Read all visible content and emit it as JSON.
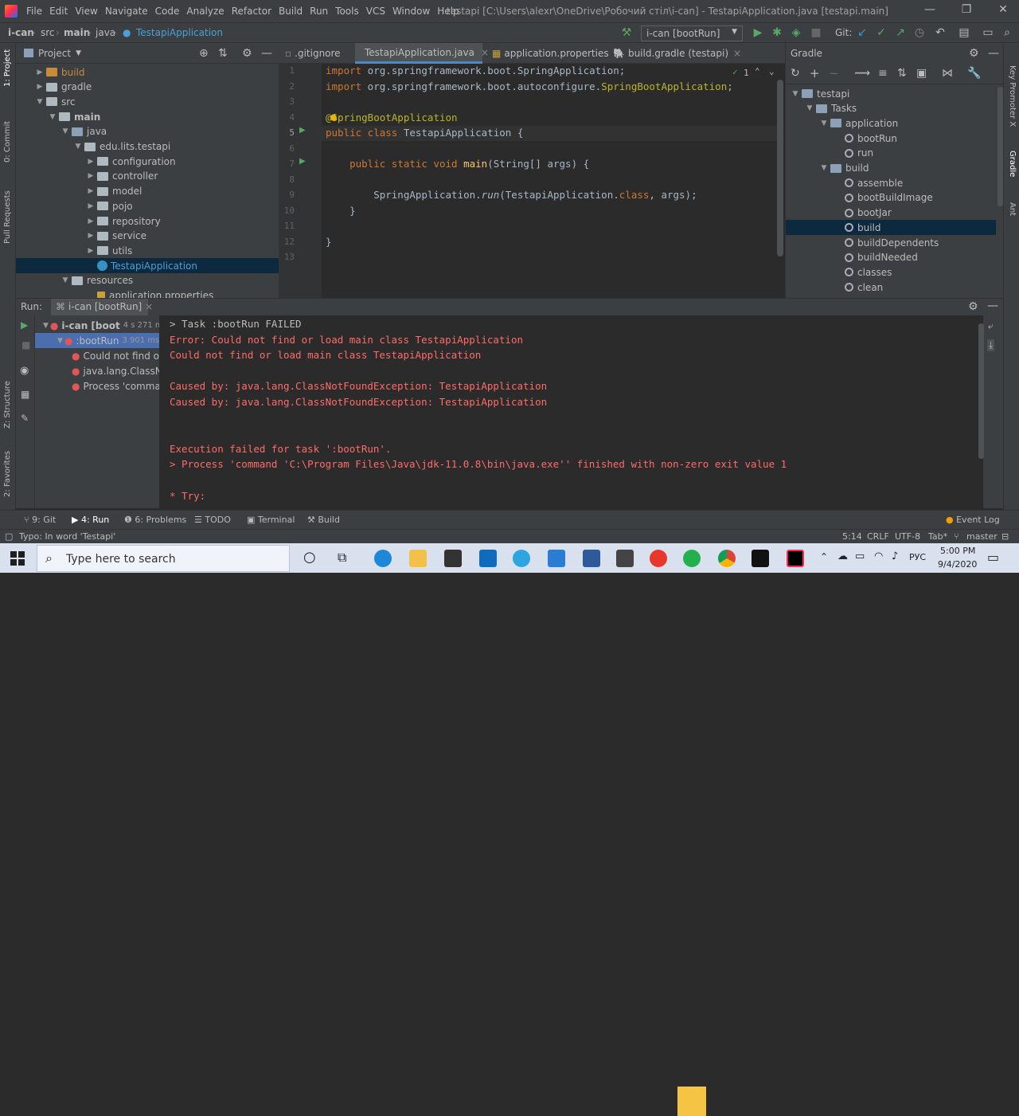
{
  "menu": [
    "File",
    "Edit",
    "View",
    "Navigate",
    "Code",
    "Analyze",
    "Refactor",
    "Build",
    "Run",
    "Tools",
    "VCS",
    "Window",
    "Help"
  ],
  "window_title": "testapi [C:\\Users\\alexr\\OneDrive\\Робочий стіл\\i-can] - TestapiApplication.java [testapi.main]",
  "breadcrumb": [
    "i-can",
    "src",
    "main",
    "java",
    "TestapiApplication"
  ],
  "run_config": "i-can [bootRun]",
  "git_label": "Git:",
  "project": {
    "header": "Project",
    "items": [
      {
        "label": "build",
        "depth": 1,
        "arrow": "▶",
        "kind": "orange"
      },
      {
        "label": "gradle",
        "depth": 1,
        "arrow": "▶",
        "kind": "folder"
      },
      {
        "label": "src",
        "depth": 1,
        "arrow": "▼",
        "kind": "folder"
      },
      {
        "label": "main",
        "depth": 2,
        "arrow": "▼",
        "kind": "folder"
      },
      {
        "label": "java",
        "depth": 3,
        "arrow": "▼",
        "kind": "blue"
      },
      {
        "label": "edu.lits.testapi",
        "depth": 4,
        "arrow": "▼",
        "kind": "folder"
      },
      {
        "label": "configuration",
        "depth": 5,
        "arrow": "▶",
        "kind": "folder"
      },
      {
        "label": "controller",
        "depth": 5,
        "arrow": "▶",
        "kind": "folder"
      },
      {
        "label": "model",
        "depth": 5,
        "arrow": "▶",
        "kind": "folder"
      },
      {
        "label": "pojo",
        "depth": 5,
        "arrow": "▶",
        "kind": "folder"
      },
      {
        "label": "repository",
        "depth": 5,
        "arrow": "▶",
        "kind": "folder"
      },
      {
        "label": "service",
        "depth": 5,
        "arrow": "▶",
        "kind": "folder"
      },
      {
        "label": "utils",
        "depth": 5,
        "arrow": "▶",
        "kind": "folder"
      },
      {
        "label": "TestapiApplication",
        "depth": 5,
        "arrow": "",
        "kind": "java",
        "selected": true
      },
      {
        "label": "resources",
        "depth": 3,
        "arrow": "▼",
        "kind": "folder"
      },
      {
        "label": "application.properties",
        "depth": 5,
        "arrow": "",
        "kind": "file"
      }
    ]
  },
  "tabs": [
    ".gitignore",
    "TestapiApplication.java",
    "application.properties",
    "build.gradle (testapi)"
  ],
  "editor": {
    "line_numbers": [
      "1",
      "2",
      "3",
      "4",
      "5",
      "6",
      "7",
      "8",
      "9",
      "10",
      "11",
      "12",
      "13"
    ],
    "inspection": "1",
    "lines": [
      {
        "html": "<span class=\"kw\">import</span> org.springframework.boot.SpringApplication;"
      },
      {
        "html": "<span class=\"kw\">import</span> org.springframework.boot.autoconfigure.<span class=\"ann\">SpringBootApplication</span>;"
      },
      {
        "html": ""
      },
      {
        "html": "<span class=\"ann\">@SpringBootApplication</span>"
      },
      {
        "html": "<span class=\"kw\">public class</span> TestapiApplication {"
      },
      {
        "html": ""
      },
      {
        "html": "    <span class=\"kw\">public static void</span> <span class=\"fn\">main</span>(String[] args) {"
      },
      {
        "html": ""
      },
      {
        "html": "        SpringApplication.<span class=\"it\">run</span>(TestapiApplication.<span class=\"kw\">class</span>, args);"
      },
      {
        "html": "    }"
      },
      {
        "html": ""
      },
      {
        "html": "}"
      },
      {
        "html": ""
      }
    ]
  },
  "gradle": {
    "header": "Gradle",
    "items": [
      {
        "label": "testapi",
        "depth": 0,
        "arrow": "▼"
      },
      {
        "label": "Tasks",
        "depth": 1,
        "arrow": "▼"
      },
      {
        "label": "application",
        "depth": 2,
        "arrow": "▼"
      },
      {
        "label": "bootRun",
        "depth": 3,
        "arrow": "",
        "gear": true
      },
      {
        "label": "run",
        "depth": 3,
        "arrow": "",
        "gear": true
      },
      {
        "label": "build",
        "depth": 2,
        "arrow": "▼"
      },
      {
        "label": "assemble",
        "depth": 3,
        "arrow": "",
        "gear": true
      },
      {
        "label": "bootBuildImage",
        "depth": 3,
        "arrow": "",
        "gear": true
      },
      {
        "label": "bootJar",
        "depth": 3,
        "arrow": "",
        "gear": true
      },
      {
        "label": "build",
        "depth": 3,
        "arrow": "",
        "gear": true,
        "selected": true
      },
      {
        "label": "buildDependents",
        "depth": 3,
        "arrow": "",
        "gear": true
      },
      {
        "label": "buildNeeded",
        "depth": 3,
        "arrow": "",
        "gear": true
      },
      {
        "label": "classes",
        "depth": 3,
        "arrow": "",
        "gear": true
      },
      {
        "label": "clean",
        "depth": 3,
        "arrow": "",
        "gear": true
      }
    ]
  },
  "run": {
    "label": "Run:",
    "tab": "i-can [bootRun]",
    "tree": [
      {
        "label": "i-can [boot",
        "time": "4 s 271 ms",
        "depth": 0,
        "selected": false
      },
      {
        "label": ":bootRun",
        "time": "3 901 ms",
        "depth": 1,
        "selected": true
      },
      {
        "label": "Could not find o",
        "depth": 2
      },
      {
        "label": "java.lang.ClassN",
        "depth": 2
      },
      {
        "label": "Process 'comma",
        "depth": 2
      }
    ],
    "console": [
      {
        "text": "> Task :bootRun FAILED",
        "cls": "gray"
      },
      {
        "text": "Error: Could not find or load main class TestapiApplication",
        "cls": "red"
      },
      {
        "text": "Could not find or load main class TestapiApplication",
        "cls": "red"
      },
      {
        "text": "",
        "cls": "red"
      },
      {
        "text": "Caused by: java.lang.ClassNotFoundException: TestapiApplication",
        "cls": "red"
      },
      {
        "text": "Caused by: java.lang.ClassNotFoundException: TestapiApplication",
        "cls": "red"
      },
      {
        "text": "",
        "cls": "red"
      },
      {
        "text": "",
        "cls": "red"
      },
      {
        "text": "Execution failed for task ':bootRun'.",
        "cls": "red"
      },
      {
        "text": "> Process 'command 'C:\\Program Files\\Java\\jdk-11.0.8\\bin\\java.exe'' finished with non-zero exit value 1",
        "cls": "red"
      },
      {
        "text": "",
        "cls": "red"
      },
      {
        "text": "* Try:",
        "cls": "red"
      }
    ]
  },
  "tooltabs": {
    "git": "9: Git",
    "run": "4: Run",
    "problems": "6: Problems",
    "todo": "TODO",
    "terminal": "Terminal",
    "build": "Build",
    "event_log": "Event Log"
  },
  "left_strip": {
    "project": "1: Project",
    "commit": "0: Commit",
    "pull": "Pull Requests",
    "structure": "Z: Structure",
    "favorites": "2: Favorites"
  },
  "right_strip": {
    "key": "Key Promoter X",
    "gradle": "Gradle",
    "ant": "Ant"
  },
  "status": {
    "message": "Typo: In word 'Testapi'",
    "position": "5:14",
    "line_sep": "CRLF",
    "encoding": "UTF-8",
    "indent": "Tab*",
    "branch": "master"
  },
  "taskbar": {
    "search": "Type here to search",
    "lang": "РУС",
    "time": "5:00 PM",
    "date": "9/4/2020"
  }
}
